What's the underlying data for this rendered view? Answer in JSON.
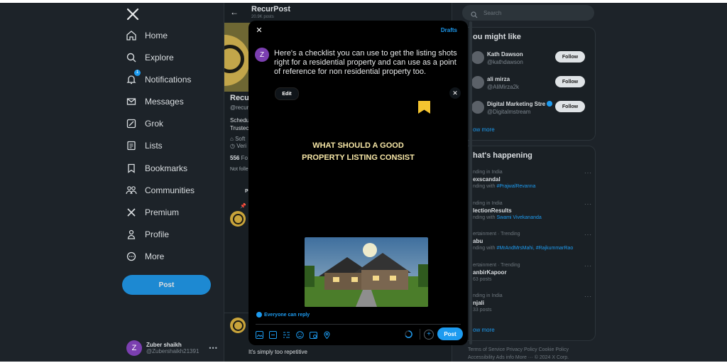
{
  "nav": {
    "items": [
      {
        "label": "Home",
        "icon": "home-icon"
      },
      {
        "label": "Explore",
        "icon": "search-icon"
      },
      {
        "label": "Notifications",
        "icon": "bell-icon",
        "badge": "1"
      },
      {
        "label": "Messages",
        "icon": "envelope-icon"
      },
      {
        "label": "Grok",
        "icon": "grok-icon"
      },
      {
        "label": "Lists",
        "icon": "list-icon"
      },
      {
        "label": "Bookmarks",
        "icon": "bookmark-icon"
      },
      {
        "label": "Communities",
        "icon": "people-icon"
      },
      {
        "label": "Premium",
        "icon": "x-logo-icon"
      },
      {
        "label": "Profile",
        "icon": "person-icon"
      },
      {
        "label": "More",
        "icon": "more-circle-icon"
      }
    ],
    "post_label": "Post",
    "account": {
      "avatar_letter": "Z",
      "name": "Zuber shaikh",
      "handle": "@Zubershaikh21391"
    }
  },
  "profile": {
    "name": "RecurPost",
    "posts_count": "20.9K posts",
    "display_name": "Recu",
    "handle": "@recur",
    "bio_line1": "Schedu",
    "bio_line2": "Trustec",
    "meta1": "Soft",
    "meta2": "Veri",
    "followers_count": "556",
    "followers_label": "Fo",
    "not_followed": "Not folle",
    "tab_initial": "P",
    "reply_text": "It's simply too repetitive"
  },
  "modal": {
    "drafts_label": "Drafts",
    "avatar_letter": "Z",
    "compose_text": "Here's a checklist you can use to get the listing shots right for a residential property and can use as a point of reference for non residential property too.",
    "edit_label": "Edit",
    "image_headline_line1": "WHAT SHOULD A GOOD",
    "image_headline_line2": "PROPERTY LISTING CONSIST",
    "reply_setting": "Everyone can reply",
    "post_label": "Post"
  },
  "right": {
    "search_placeholder": "Search",
    "who_title": "ou might like",
    "who": [
      {
        "name": "Kath Dawson",
        "handle": "@kathdawson",
        "verified": false
      },
      {
        "name": "ali mirza",
        "handle": "@AliMirza2k",
        "verified": false
      },
      {
        "name": "Digital Marketing Stre",
        "handle": "@Digitalmstream",
        "verified": true
      }
    ],
    "follow_label": "Follow",
    "show_more": "ow more",
    "trends_title": "hat's happening",
    "trends": [
      {
        "context": "nding in India",
        "title": "exscandal",
        "sub_prefix": "nding with ",
        "sub_link": "#PrajwalRevanna"
      },
      {
        "context": "nding in India",
        "title": "lectionResults",
        "sub_prefix": "nding with ",
        "sub_link": "Swami Vivekananda"
      },
      {
        "context": "ertainment · Trending",
        "title": "abu",
        "sub_prefix": "nding with ",
        "sub_link": "#MrAndMrsMahi, #RajkummarRao"
      },
      {
        "context": "ertainment · Trending",
        "title": "anbirKapoor",
        "sub_prefix": "63 posts",
        "sub_link": ""
      },
      {
        "context": "nding in India",
        "title": "njali",
        "sub_prefix": "33 posts",
        "sub_link": ""
      }
    ],
    "show_more_2": "ow more",
    "footer_line1": "Terms of Service   Privacy Policy   Cookie Policy",
    "footer_line2": "Accessibility   Ads info   More ···   © 2024 X Corp."
  }
}
